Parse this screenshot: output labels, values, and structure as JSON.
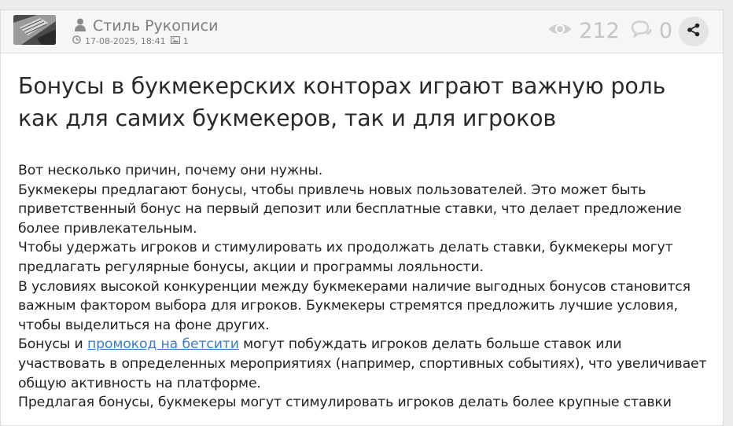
{
  "author": {
    "name": "Стиль Рукописи"
  },
  "meta": {
    "datetime": "17-08-2025, 18:41",
    "images": "1"
  },
  "stats": {
    "views": "212",
    "comments": "0"
  },
  "article": {
    "title": "Бонусы в букмекерских конторах играют важную роль как для самих букмекеров, так и для игроков",
    "p1": "Вот несколько причин, почему они нужны.",
    "p2": "Букмекеры предлагают бонусы, чтобы привлечь новых пользователей. Это может быть приветственный бонус на первый депозит или бесплатные ставки, что делает предложение более привлекательным.",
    "p3": "Чтобы удержать игроков и стимулировать их продолжать делать ставки, букмекеры могут предлагать регулярные бонусы, акции и программы лояльности.",
    "p4": "В условиях высокой конкуренции между букмекерами наличие выгодных бонусов становится важным фактором выбора для игроков. Букмекеры стремятся предложить лучшие условия, чтобы выделиться на фоне других.",
    "p5_before": "Бонусы и ",
    "p5_link": "промокод на бетсити",
    "p5_after": " могут побуждать игроков делать больше ставок или участвовать в определенных мероприятиях (например, спортивных событиях), что увеличивает общую активность на платформе.",
    "p6": "Предлагая бонусы, букмекеры могут стимулировать игроков делать более крупные ставки"
  },
  "icons": {
    "user": "user-icon",
    "clock": "clock-icon",
    "image": "image-icon",
    "eye": "eye-icon",
    "comment": "comment-icon",
    "share": "share-icon"
  },
  "colors": {
    "link": "#3f7cc3",
    "header_bg": "#f6f6f6",
    "muted": "#7d7d7d"
  }
}
